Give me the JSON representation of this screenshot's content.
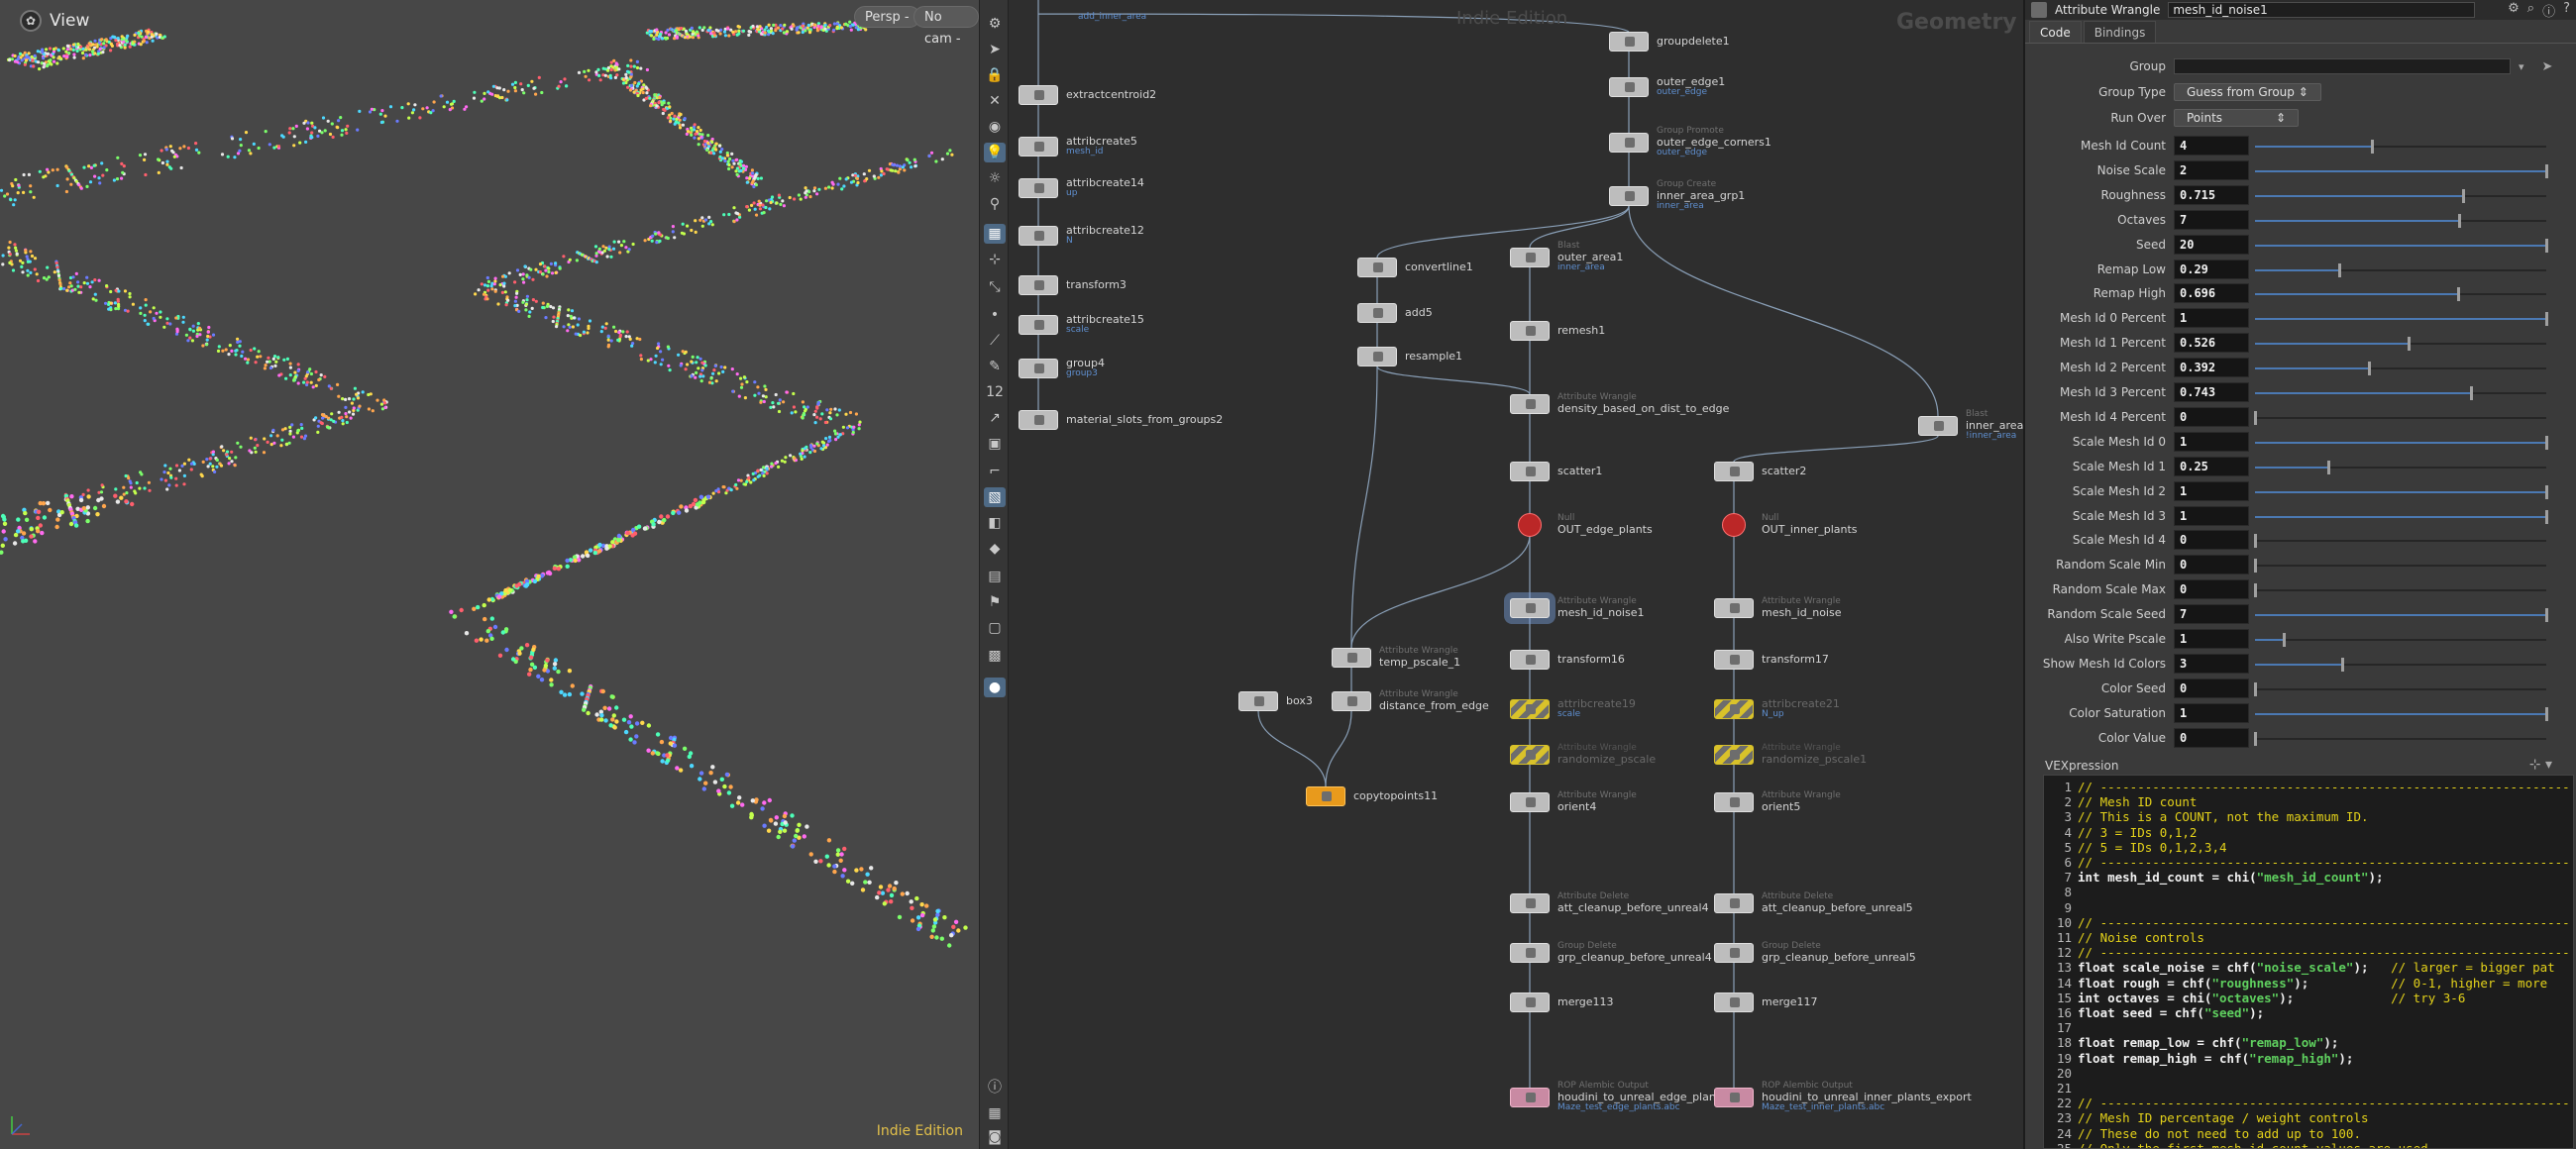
{
  "viewport": {
    "title": "View",
    "persp_label": "Persp -",
    "cam_label": "No cam -",
    "edition": "Indie Edition"
  },
  "network": {
    "watermark_edition": "Indie Edition",
    "watermark_context": "Geometry",
    "nodes": [
      {
        "id": "top_comment",
        "type": "",
        "label": "",
        "comment": "add_inner_area"
      },
      {
        "id": "extractcentroid2",
        "type": "",
        "label": "extractcentroid2",
        "comment": ""
      },
      {
        "id": "attribcreate5",
        "type": "",
        "label": "attribcreate5",
        "comment": "mesh_id"
      },
      {
        "id": "attribcreate14",
        "type": "",
        "label": "attribcreate14",
        "comment": "up"
      },
      {
        "id": "attribcreate12",
        "type": "",
        "label": "attribcreate12",
        "comment": "N"
      },
      {
        "id": "transform3",
        "type": "",
        "label": "transform3",
        "comment": ""
      },
      {
        "id": "attribcreate15",
        "type": "",
        "label": "attribcreate15",
        "comment": "scale"
      },
      {
        "id": "group4",
        "type": "",
        "label": "group4",
        "comment": "group3"
      },
      {
        "id": "material_slots",
        "type": "",
        "label": "material_slots_from_groups2",
        "comment": ""
      },
      {
        "id": "groupdelete1",
        "type": "",
        "label": "groupdelete1",
        "comment": ""
      },
      {
        "id": "outer_edge1",
        "type": "",
        "label": "outer_edge1",
        "comment": "outer_edge"
      },
      {
        "id": "outer_edge_corners1",
        "type": "Group Promote",
        "label": "outer_edge_corners1",
        "comment": "outer_edge"
      },
      {
        "id": "inner_area_grp1",
        "type": "Group Create",
        "label": "inner_area_grp1",
        "comment": "inner_area"
      },
      {
        "id": "convertline1",
        "type": "",
        "label": "convertline1",
        "comment": ""
      },
      {
        "id": "add5",
        "type": "",
        "label": "add5",
        "comment": ""
      },
      {
        "id": "resample1",
        "type": "",
        "label": "resample1",
        "comment": ""
      },
      {
        "id": "outer_area1",
        "type": "Blast",
        "label": "outer_area1",
        "comment": "inner_area"
      },
      {
        "id": "remesh1",
        "type": "",
        "label": "remesh1",
        "comment": ""
      },
      {
        "id": "density",
        "type": "Attribute Wrangle",
        "label": "density_based_on_dist_to_edge",
        "comment": ""
      },
      {
        "id": "inner_area1",
        "type": "Blast",
        "label": "inner_area1",
        "comment": "!inner_area"
      },
      {
        "id": "scatter1",
        "type": "",
        "label": "scatter1",
        "comment": ""
      },
      {
        "id": "scatter2",
        "type": "",
        "label": "scatter2",
        "comment": ""
      },
      {
        "id": "out_edge",
        "type": "Null",
        "label": "OUT_edge_plants",
        "comment": ""
      },
      {
        "id": "out_inner",
        "type": "Null",
        "label": "OUT_inner_plants",
        "comment": ""
      },
      {
        "id": "mesh_id_noise1",
        "type": "Attribute Wrangle",
        "label": "mesh_id_noise1",
        "comment": ""
      },
      {
        "id": "mesh_id_noise",
        "type": "Attribute Wrangle",
        "label": "mesh_id_noise",
        "comment": ""
      },
      {
        "id": "temp_pscale_1",
        "type": "Attribute Wrangle",
        "label": "temp_pscale_1",
        "comment": ""
      },
      {
        "id": "distance_from_edge",
        "type": "Attribute Wrangle",
        "label": "distance_from_edge",
        "comment": ""
      },
      {
        "id": "box3",
        "type": "",
        "label": "box3",
        "comment": ""
      },
      {
        "id": "transform16",
        "type": "",
        "label": "transform16",
        "comment": ""
      },
      {
        "id": "transform17",
        "type": "",
        "label": "transform17",
        "comment": ""
      },
      {
        "id": "attribcreate19",
        "type": "",
        "label": "attribcreate19",
        "comment": "scale"
      },
      {
        "id": "attribcreate21",
        "type": "",
        "label": "attribcreate21",
        "comment": "N_up"
      },
      {
        "id": "randpscale",
        "type": "Attribute Wrangle",
        "label": "randomize_pscale",
        "comment": ""
      },
      {
        "id": "randpscale1",
        "type": "Attribute Wrangle",
        "label": "randomize_pscale1",
        "comment": ""
      },
      {
        "id": "copytopoints11",
        "type": "",
        "label": "copytopoints11",
        "comment": ""
      },
      {
        "id": "orient4",
        "type": "Attribute Wrangle",
        "label": "orient4",
        "comment": ""
      },
      {
        "id": "orient5",
        "type": "Attribute Wrangle",
        "label": "orient5",
        "comment": ""
      },
      {
        "id": "att_cleanup4",
        "type": "Attribute Delete",
        "label": "att_cleanup_before_unreal4",
        "comment": ""
      },
      {
        "id": "att_cleanup5",
        "type": "Attribute Delete",
        "label": "att_cleanup_before_unreal5",
        "comment": ""
      },
      {
        "id": "grp_cleanup4",
        "type": "Group Delete",
        "label": "grp_cleanup_before_unreal4",
        "comment": ""
      },
      {
        "id": "grp_cleanup5",
        "type": "Group Delete",
        "label": "grp_cleanup_before_unreal5",
        "comment": ""
      },
      {
        "id": "merge113",
        "type": "",
        "label": "merge113",
        "comment": ""
      },
      {
        "id": "merge117",
        "type": "",
        "label": "merge117",
        "comment": ""
      },
      {
        "id": "export_edge",
        "type": "ROP Alembic Output",
        "label": "houdini_to_unreal_edge_plants_exp",
        "comment": "Maze_test_edge_plants.abc"
      },
      {
        "id": "export_inner",
        "type": "ROP Alembic Output",
        "label": "houdini_to_unreal_inner_plants_export",
        "comment": "Maze_test_inner_plants.abc"
      }
    ]
  },
  "params": {
    "node_type": "Attribute Wrangle",
    "node_name": "mesh_id_noise1",
    "tabs": [
      "Code",
      "Bindings"
    ],
    "group_label": "Group",
    "group_type_label": "Group Type",
    "group_type_value": "Guess from Group",
    "run_over_label": "Run Over",
    "run_over_value": "Points",
    "rows": [
      {
        "label": "Mesh Id Count",
        "value": "4",
        "frac": 0.4
      },
      {
        "label": "Noise Scale",
        "value": "2",
        "frac": 1.0
      },
      {
        "label": "Roughness",
        "value": "0.715",
        "frac": 0.715
      },
      {
        "label": "Octaves",
        "value": "7",
        "frac": 0.7
      },
      {
        "label": "Seed",
        "value": "20",
        "frac": 1.0
      },
      {
        "label": "Remap Low",
        "value": "0.29",
        "frac": 0.29
      },
      {
        "label": "Remap High",
        "value": "0.696",
        "frac": 0.696
      },
      {
        "label": "Mesh Id 0 Percent",
        "value": "1",
        "frac": 1.0
      },
      {
        "label": "Mesh Id 1 Percent",
        "value": "0.526",
        "frac": 0.526
      },
      {
        "label": "Mesh Id 2 Percent",
        "value": "0.392",
        "frac": 0.392
      },
      {
        "label": "Mesh Id 3 Percent",
        "value": "0.743",
        "frac": 0.743
      },
      {
        "label": "Mesh Id 4 Percent",
        "value": "0",
        "frac": 0.0
      },
      {
        "label": "Scale Mesh Id 0",
        "value": "1",
        "frac": 1.0
      },
      {
        "label": "Scale Mesh Id 1",
        "value": "0.25",
        "frac": 0.25
      },
      {
        "label": "Scale Mesh Id 2",
        "value": "1",
        "frac": 1.0
      },
      {
        "label": "Scale Mesh Id 3",
        "value": "1",
        "frac": 1.0
      },
      {
        "label": "Scale Mesh Id 4",
        "value": "0",
        "frac": 0.0
      },
      {
        "label": "Random Scale Min",
        "value": "0",
        "frac": 0.0
      },
      {
        "label": "Random Scale Max",
        "value": "0",
        "frac": 0.0
      },
      {
        "label": "Random Scale Seed",
        "value": "7",
        "frac": 1.0
      },
      {
        "label": "Also Write Pscale",
        "value": "1",
        "frac": 0.1
      },
      {
        "label": "Show Mesh Id Colors",
        "value": "3",
        "frac": 0.3
      },
      {
        "label": "Color Seed",
        "value": "0",
        "frac": 0.0
      },
      {
        "label": "Color Saturation",
        "value": "1",
        "frac": 1.0
      },
      {
        "label": "Color Value",
        "value": "0",
        "frac": 0.0
      }
    ],
    "vex_label": "VEXpression",
    "code_lines": [
      "// ---------------------------------------------------------------",
      "// Mesh ID count",
      "// This is a COUNT, not the maximum ID.",
      "// 3 = IDs 0,1,2",
      "// 5 = IDs 0,1,2,3,4",
      "// ---------------------------------------------------------------",
      "int mesh_id_count = chi(\"mesh_id_count\");",
      "",
      "",
      "// ---------------------------------------------------------------",
      "// Noise controls",
      "// ---------------------------------------------------------------",
      "float scale_noise = chf(\"noise_scale\");   // larger = bigger pat",
      "float rough = chf(\"roughness\");           // 0-1, higher = more",
      "int octaves = chi(\"octaves\");             // try 3-6",
      "float seed = chf(\"seed\");",
      "",
      "float remap_low = chf(\"remap_low\");",
      "float remap_high = chf(\"remap_high\");",
      "",
      "",
      "// ---------------------------------------------------------------",
      "// Mesh ID percentage / weight controls",
      "// These do not need to add up to 100.",
      "// Only the first mesh_id_count values are used."
    ]
  }
}
